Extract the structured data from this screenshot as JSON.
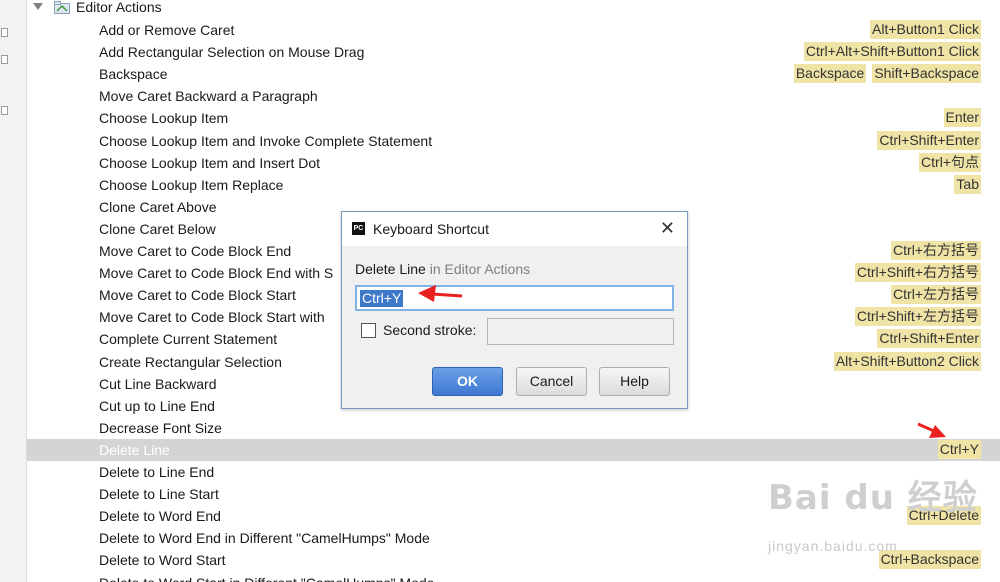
{
  "tree": {
    "group_label": "Editor Actions",
    "rows": [
      {
        "label": "Add or Remove Caret",
        "shortcuts": [
          "Alt+Button1 Click"
        ]
      },
      {
        "label": "Add Rectangular Selection on Mouse Drag",
        "shortcuts": [
          "Ctrl+Alt+Shift+Button1 Click"
        ]
      },
      {
        "label": "Backspace",
        "shortcuts": [
          "Backspace",
          "Shift+Backspace"
        ]
      },
      {
        "label": "Move Caret Backward a Paragraph",
        "shortcuts": []
      },
      {
        "label": "Choose Lookup Item",
        "shortcuts": [
          "Enter"
        ]
      },
      {
        "label": "Choose Lookup Item and Invoke Complete Statement",
        "shortcuts": [
          "Ctrl+Shift+Enter"
        ]
      },
      {
        "label": "Choose Lookup Item and Insert Dot",
        "shortcuts": [
          "Ctrl+句点"
        ]
      },
      {
        "label": "Choose Lookup Item Replace",
        "shortcuts": [
          "Tab"
        ]
      },
      {
        "label": "Clone Caret Above",
        "shortcuts": []
      },
      {
        "label": "Clone Caret Below",
        "shortcuts": []
      },
      {
        "label": "Move Caret to Code Block End",
        "shortcuts": [
          "Ctrl+右方括号"
        ]
      },
      {
        "label": "Move Caret to Code Block End with S",
        "shortcuts": [
          "Ctrl+Shift+右方括号"
        ]
      },
      {
        "label": "Move Caret to Code Block Start",
        "shortcuts": [
          "Ctrl+左方括号"
        ]
      },
      {
        "label": "Move Caret to Code Block Start with",
        "shortcuts": [
          "Ctrl+Shift+左方括号"
        ]
      },
      {
        "label": "Complete Current Statement",
        "shortcuts": [
          "Ctrl+Shift+Enter"
        ]
      },
      {
        "label": "Create Rectangular Selection",
        "shortcuts": [
          "Alt+Shift+Button2 Click"
        ]
      },
      {
        "label": "Cut Line Backward",
        "shortcuts": []
      },
      {
        "label": "Cut up to Line End",
        "shortcuts": []
      },
      {
        "label": "Decrease Font Size",
        "shortcuts": []
      },
      {
        "label": "Delete Line",
        "shortcuts": [
          "Ctrl+Y"
        ],
        "selected": true
      },
      {
        "label": "Delete to Line End",
        "shortcuts": []
      },
      {
        "label": "Delete to Line Start",
        "shortcuts": []
      },
      {
        "label": "Delete to Word End",
        "shortcuts": [
          "Ctrl+Delete"
        ]
      },
      {
        "label": "Delete to Word End in Different \"CamelHumps\" Mode",
        "shortcuts": []
      },
      {
        "label": "Delete to Word Start",
        "shortcuts": [
          "Ctrl+Backspace"
        ]
      },
      {
        "label": "Delete to Word Start in Different \"CamelHumps\" Mode",
        "shortcuts": []
      }
    ]
  },
  "dialog": {
    "app_icon_text": "PC",
    "title": "Keyboard Shortcut",
    "heading_action": "Delete Line",
    "heading_context": " in Editor Actions",
    "shortcut_value": "Ctrl+Y",
    "second_stroke_label": "Second stroke:",
    "second_stroke_value": "",
    "ok_label": "OK",
    "cancel_label": "Cancel",
    "help_label": "Help"
  },
  "watermark": {
    "logo_text": "Bai du 经验",
    "url": "jingyan.baidu.com"
  },
  "colors": {
    "shortcut_chip": "#efe3a6",
    "selection_row": "#d4d4d4",
    "arrow": "#e8201e",
    "ok_button": "#3f78d2",
    "input_selection": "#3d78c9"
  }
}
